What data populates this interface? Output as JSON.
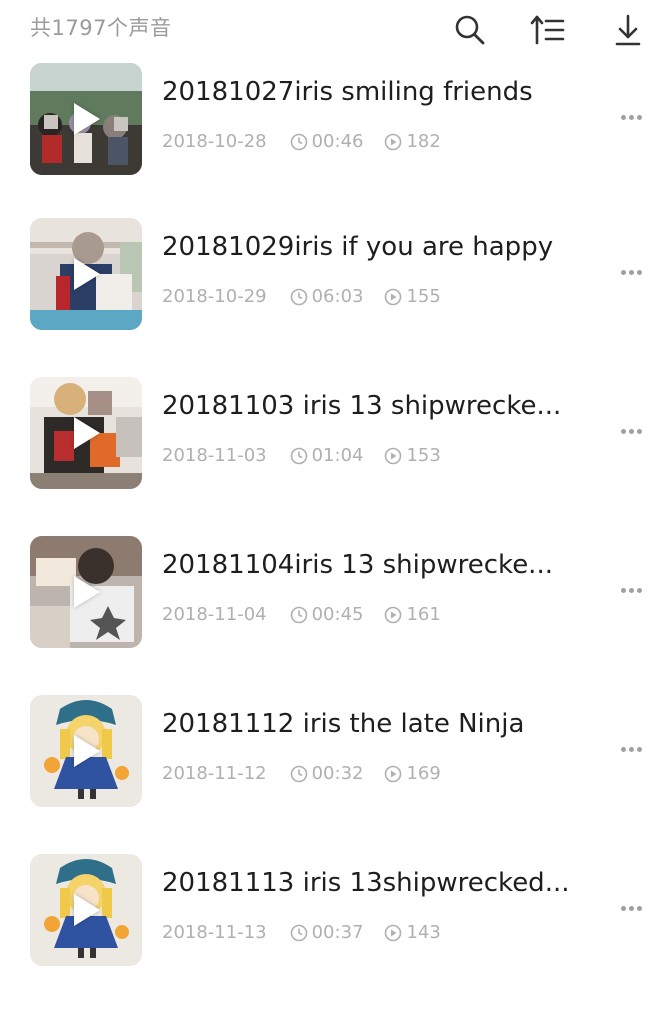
{
  "header": {
    "count_text": "共1797个声音",
    "icons": [
      "search-icon",
      "sort-icon",
      "download-icon"
    ]
  },
  "tracks": [
    {
      "title": "20181027iris smiling friends",
      "date": "2018-10-28",
      "duration": "00:46",
      "plays": "182",
      "thumb": "photo-outdoor-group"
    },
    {
      "title": "20181029iris if you are happy",
      "date": "2018-10-29",
      "duration": "06:03",
      "plays": "155",
      "thumb": "photo-child-balcony"
    },
    {
      "title": "20181103 iris 13 shipwrecke...",
      "date": "2018-11-03",
      "duration": "01:04",
      "plays": "153",
      "thumb": "photo-child-costume"
    },
    {
      "title": "20181104iris 13 shipwrecke...",
      "date": "2018-11-04",
      "duration": "00:45",
      "plays": "161",
      "thumb": "photo-child-indoor"
    },
    {
      "title": "20181112 iris the late Ninja",
      "date": "2018-11-12",
      "duration": "00:32",
      "plays": "169",
      "thumb": "illustration-girl-blue-dress"
    },
    {
      "title": "20181113 iris 13shipwrecked...",
      "date": "2018-11-13",
      "duration": "00:37",
      "plays": "143",
      "thumb": "illustration-girl-blue-dress"
    }
  ],
  "colors": {
    "title_text": "#1e1e1e",
    "meta_text": "#b0b0b0",
    "header_text": "#9b9b9b",
    "icon_stroke": "#333333"
  }
}
